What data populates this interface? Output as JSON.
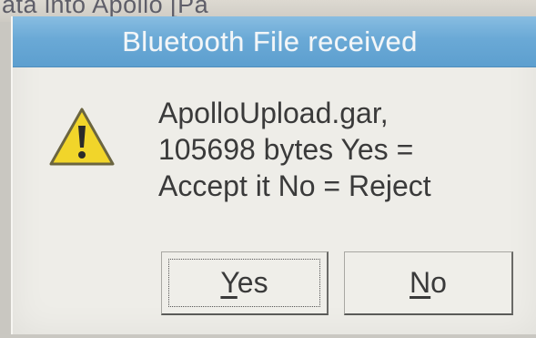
{
  "background": {
    "partial_text": "ata into Apollo [Pa"
  },
  "dialog": {
    "title": "Bluetooth File received",
    "icon": "warning-icon",
    "message_lines": [
      "ApolloUpload.gar,",
      "105698   bytes Yes =",
      "Accept it No = Reject"
    ]
  },
  "buttons": {
    "yes": {
      "mnemonic": "Y",
      "rest": "es"
    },
    "no": {
      "mnemonic": "N",
      "rest": "o"
    }
  },
  "colors": {
    "titlebar": "#6aa9d6",
    "dialog_background": "#eeede8",
    "warning_fill": "#f1d52a"
  }
}
